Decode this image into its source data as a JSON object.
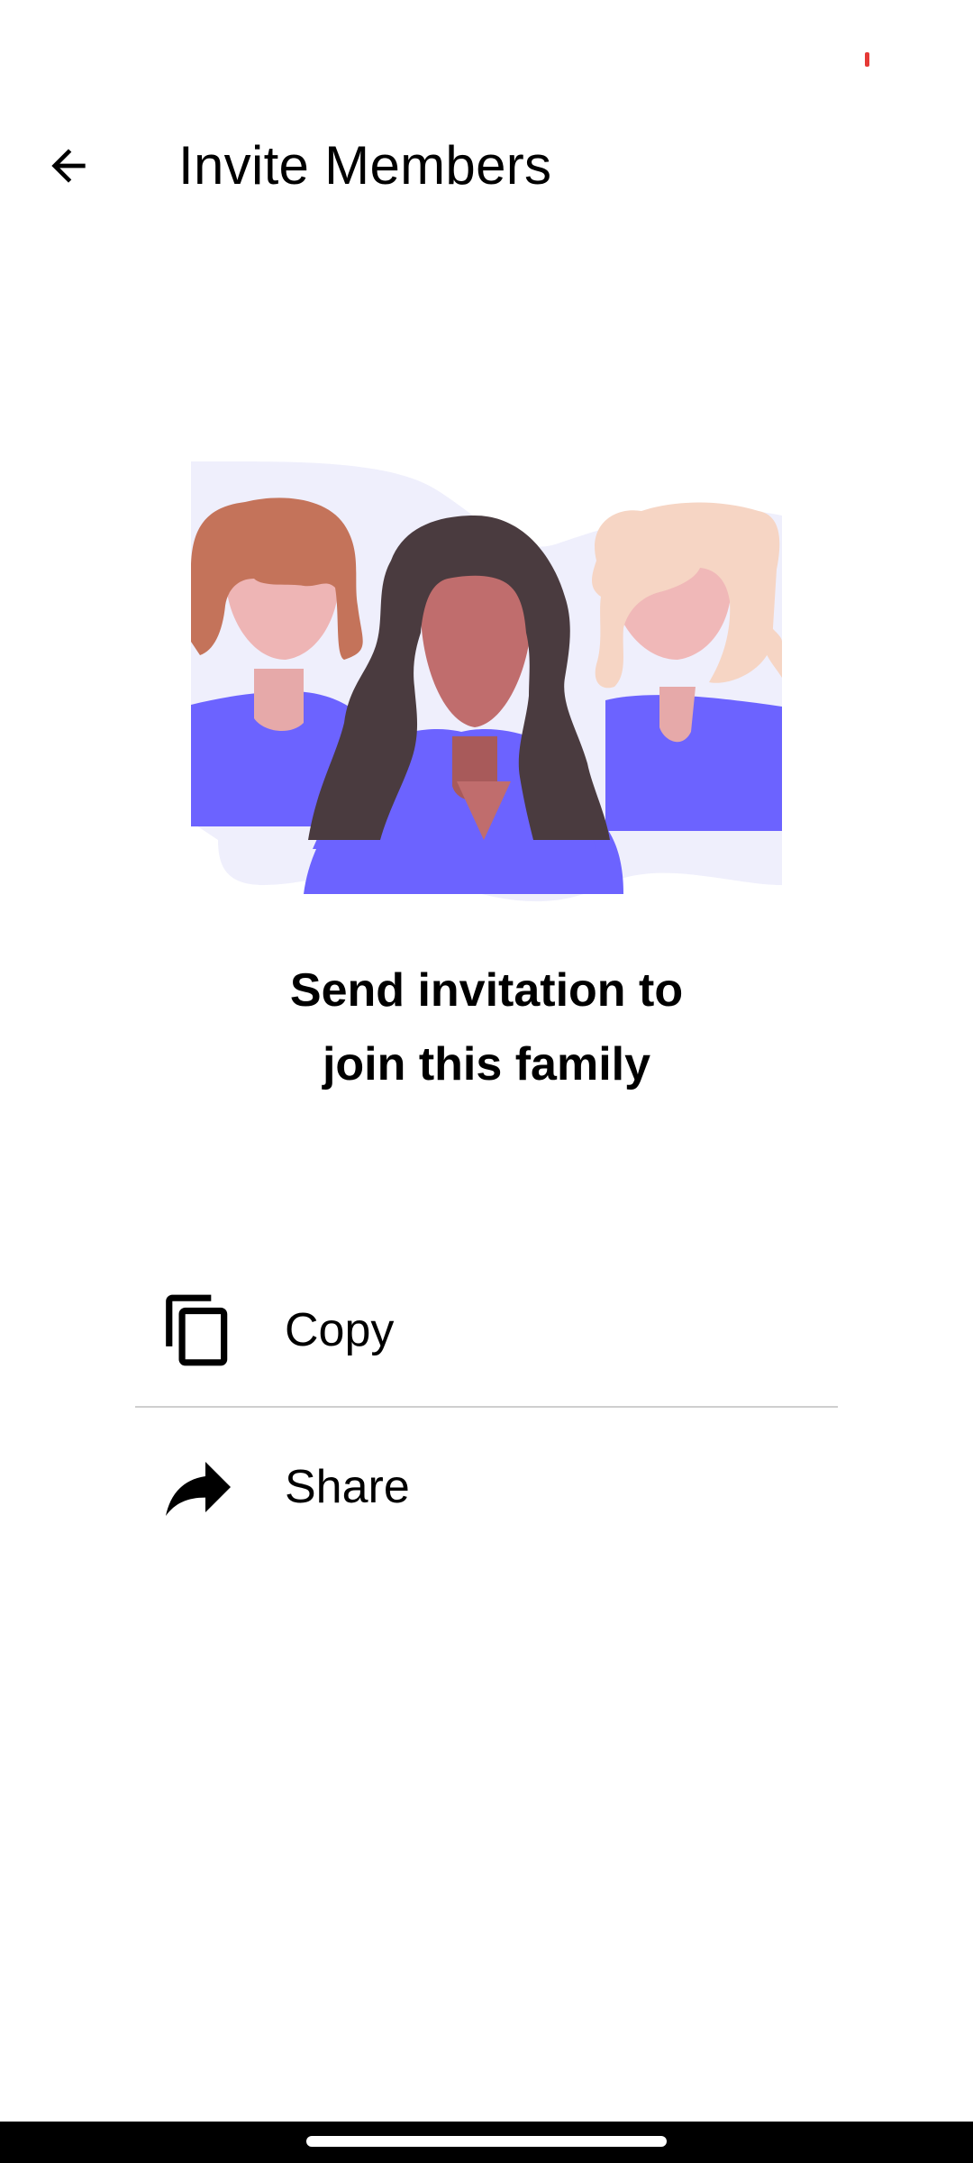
{
  "status_bar": {
    "indicator_color": "#e53935"
  },
  "app_bar": {
    "back_icon": "arrow-left-icon",
    "title": "Invite Members"
  },
  "illustration": {
    "icon": "group-of-people-illustration",
    "colors": {
      "background_blob": "#efeffc",
      "shirt": "#6c63ff",
      "left_hair": "#c4735a",
      "left_skin": "#eeb5b5",
      "center_hair": "#4a3b3f",
      "center_skin": "#c06d6d",
      "right_hair": "#f6d5c4",
      "right_skin": "#f0b8b8"
    }
  },
  "headline": {
    "line1": "Send invitation to",
    "line2": "join this family"
  },
  "actions": [
    {
      "icon": "copy-icon",
      "label": "Copy"
    },
    {
      "icon": "share-icon",
      "label": "Share"
    }
  ],
  "colors": {
    "divider": "#cfcfcf",
    "text": "#000000",
    "background": "#ffffff"
  }
}
